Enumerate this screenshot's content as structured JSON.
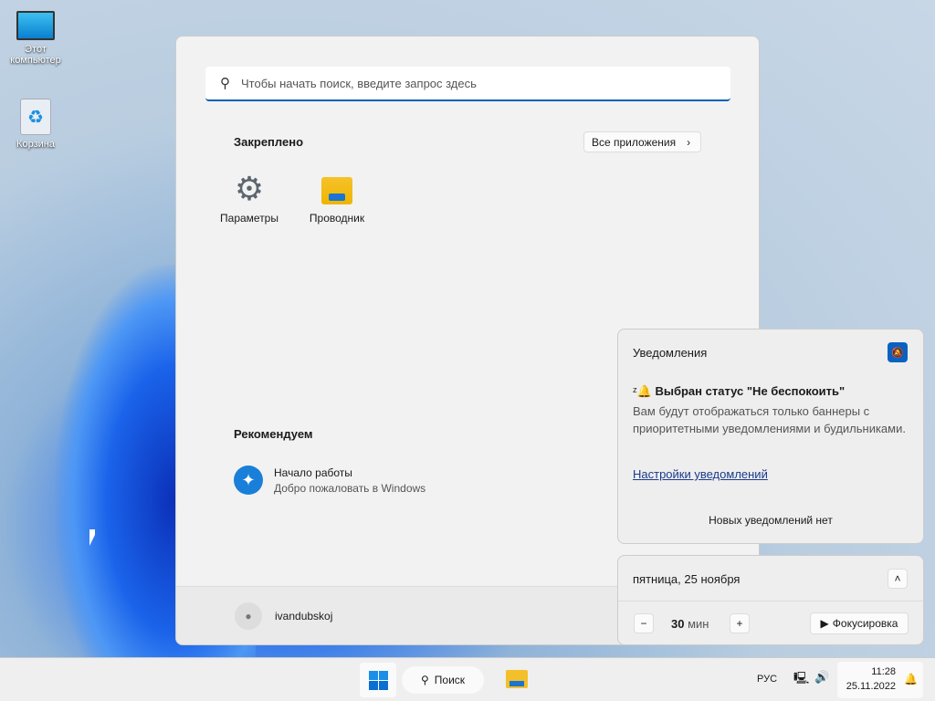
{
  "desktop": {
    "icons": [
      {
        "label": "Этот компьютер"
      },
      {
        "label": "Корзина"
      }
    ]
  },
  "start": {
    "search_placeholder": "Чтобы начать поиск, введите запрос здесь",
    "pinned_title": "Закреплено",
    "all_apps": "Все приложения",
    "pinned": [
      {
        "label": "Параметры"
      },
      {
        "label": "Проводник"
      }
    ],
    "recommended_title": "Рекомендуем",
    "recommended": [
      {
        "title": "Начало работы",
        "subtitle": "Добро пожаловать в Windows"
      }
    ],
    "user": "ivandubskoj"
  },
  "notifications": {
    "title": "Уведомления",
    "dnd_title": "Выбран статус \"Не беспокоить\"",
    "dnd_text": "Вам будут отображаться только баннеры с приоритетными уведомлениями и будильниками.",
    "settings_link": "Настройки уведомлений",
    "empty": "Новых уведомлений нет"
  },
  "calendar": {
    "date": "пятница, 25 ноября",
    "focus_value": "30",
    "focus_unit": "мин",
    "focus_button": "Фокусировка"
  },
  "taskbar": {
    "search": "Поиск",
    "lang": "РУС",
    "time": "11:28",
    "date": "25.11.2022"
  },
  "colors": {
    "accent": "#005fb8",
    "link": "#1a3a8c"
  }
}
